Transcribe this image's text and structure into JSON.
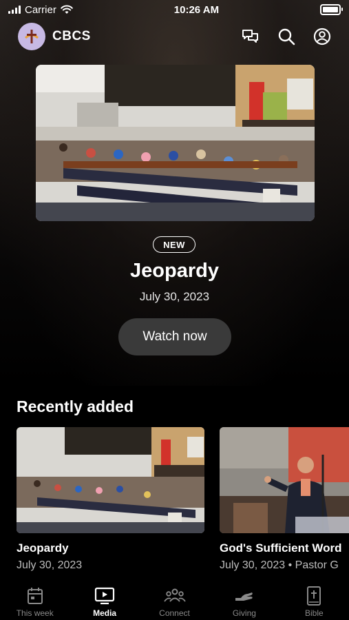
{
  "status_bar": {
    "carrier": "Carrier",
    "time": "10:26 AM"
  },
  "header": {
    "app_name": "CBCS",
    "icons": [
      "chat-bubbles-icon",
      "search-icon",
      "profile-icon"
    ]
  },
  "hero": {
    "badge": "NEW",
    "title": "Jeopardy",
    "date": "July 30, 2023",
    "button_label": "Watch now"
  },
  "recent": {
    "section_title": "Recently added",
    "items": [
      {
        "title": "Jeopardy",
        "subtitle": "July 30, 2023"
      },
      {
        "title": "God's Sufficient Word",
        "subtitle": "July 30, 2023 • Pastor G"
      }
    ]
  },
  "tabbar": {
    "tabs": [
      {
        "label": "This week",
        "icon": "calendar-icon",
        "active": false
      },
      {
        "label": "Media",
        "icon": "tv-play-icon",
        "active": true
      },
      {
        "label": "Connect",
        "icon": "people-icon",
        "active": false
      },
      {
        "label": "Giving",
        "icon": "hand-icon",
        "active": false
      },
      {
        "label": "Bible",
        "icon": "bible-icon",
        "active": false
      }
    ]
  },
  "colors": {
    "background": "#000000",
    "button_bg": "#3a3a3a",
    "logo_bg": "#c7b9e4",
    "inactive_tab": "#8a8a8a"
  }
}
